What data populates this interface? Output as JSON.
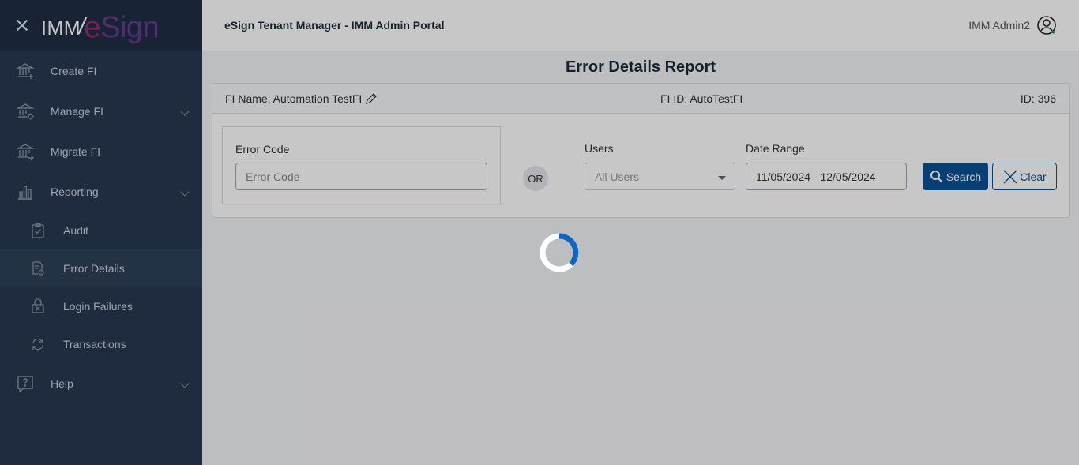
{
  "brand": {
    "imm": "IMM",
    "slash": "/",
    "esign_e": "e",
    "esign_rest": "Sign"
  },
  "sidebar": {
    "items": [
      {
        "label": "Create FI",
        "icon": "bank-plus-icon"
      },
      {
        "label": "Manage FI",
        "icon": "bank-gear-icon"
      },
      {
        "label": "Migrate FI",
        "icon": "bank-arrow-icon"
      },
      {
        "label": "Reporting",
        "icon": "bar-chart-icon"
      },
      {
        "label": "Audit",
        "icon": "clipboard-check-icon"
      },
      {
        "label": "Error Details",
        "icon": "document-search-icon"
      },
      {
        "label": "Login Failures",
        "icon": "lock-x-icon"
      },
      {
        "label": "Transactions",
        "icon": "sync-icon"
      },
      {
        "label": "Help",
        "icon": "question-bubble-icon"
      }
    ]
  },
  "header": {
    "title": "eSign Tenant Manager - IMM Admin Portal",
    "user": "IMM Admin2"
  },
  "main": {
    "report_title": "Error Details Report",
    "fi_name": "FI Name: Automation TestFI",
    "fi_id": "FI ID: AutoTestFI",
    "id": "ID: 396",
    "error_code_label": "Error Code",
    "error_code_placeholder": "Error Code",
    "or_label": "OR",
    "users_label": "Users",
    "users_value": "All Users",
    "date_range_label": "Date Range",
    "date_range_value": "11/05/2024 - 12/05/2024",
    "search_label": "Search",
    "clear_label": "Clear"
  },
  "colors": {
    "sidebar": "#283851",
    "primary": "#0a5196",
    "brand_magenta": "#9b2a72"
  }
}
